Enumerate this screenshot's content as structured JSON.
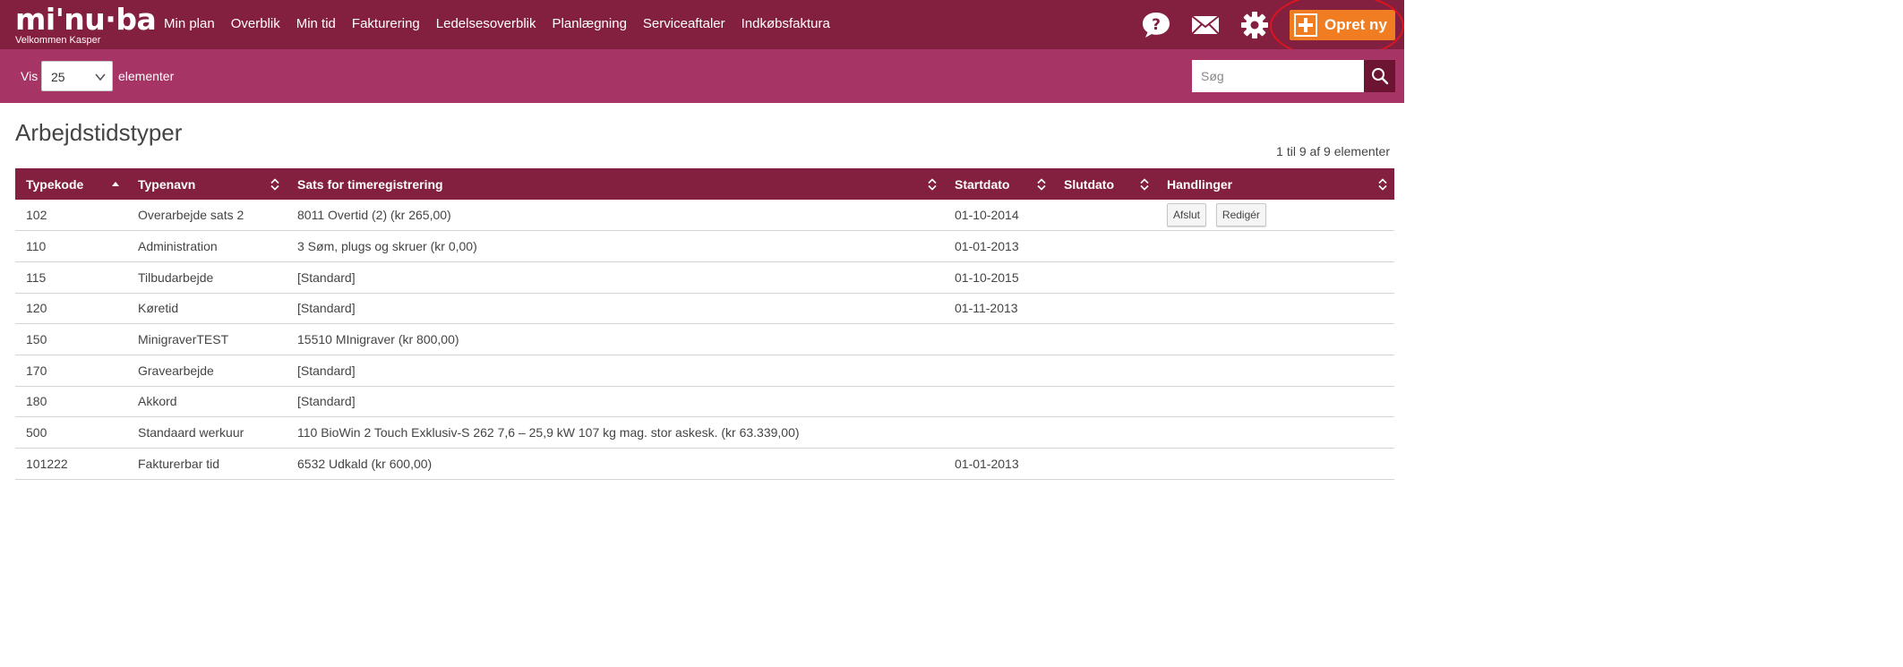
{
  "app": {
    "logo_text": "mi'nu·ba",
    "welcome": "Velkommen  Kasper"
  },
  "nav": {
    "items": [
      {
        "label": "Min plan"
      },
      {
        "label": "Overblik"
      },
      {
        "label": "Min tid"
      },
      {
        "label": "Fakturering"
      },
      {
        "label": "Ledelsesoverblik"
      },
      {
        "label": "Planlægning"
      },
      {
        "label": "Serviceaftaler"
      },
      {
        "label": "Indkøbsfaktura"
      }
    ],
    "icons": [
      "help-icon",
      "mail-icon",
      "gear-icon"
    ],
    "create_label": "Opret ny"
  },
  "toolbar": {
    "vis_label": "Vis",
    "page_size": "25",
    "elements_label": "elementer",
    "search_placeholder": "Søg"
  },
  "page": {
    "title": "Arbejdstidstyper",
    "count_info": "1 til 9 af 9 elementer"
  },
  "table": {
    "columns": [
      {
        "label": "Typekode",
        "sort": "asc"
      },
      {
        "label": "Typenavn",
        "sort": "both"
      },
      {
        "label": "Sats for timeregistrering",
        "sort": "both"
      },
      {
        "label": "Startdato",
        "sort": "both"
      },
      {
        "label": "Slutdato",
        "sort": "both"
      },
      {
        "label": "Handlinger",
        "sort": "both"
      }
    ],
    "rows": [
      {
        "code": "102",
        "name": "Overarbejde sats 2",
        "rate": "8011 Overtid (2) (kr 265,00)",
        "start": "01-10-2014",
        "end": "",
        "actions": [
          "Afslut",
          "Redigér"
        ]
      },
      {
        "code": "110",
        "name": "Administration",
        "rate": "3 Søm, plugs og skruer (kr 0,00)",
        "start": "01-01-2013",
        "end": "",
        "actions": []
      },
      {
        "code": "115",
        "name": "Tilbudarbejde",
        "rate": "[Standard]",
        "start": "01-10-2015",
        "end": "",
        "actions": []
      },
      {
        "code": "120",
        "name": "Køretid",
        "rate": "[Standard]",
        "start": "01-11-2013",
        "end": "",
        "actions": []
      },
      {
        "code": "150",
        "name": "MinigraverTEST",
        "rate": "15510 MInigraver (kr 800,00)",
        "start": "",
        "end": "",
        "actions": []
      },
      {
        "code": "170",
        "name": "Gravearbejde",
        "rate": "[Standard]",
        "start": "",
        "end": "",
        "actions": []
      },
      {
        "code": "180",
        "name": "Akkord",
        "rate": "[Standard]",
        "start": "",
        "end": "",
        "actions": []
      },
      {
        "code": "500",
        "name": "Standaard werkuur",
        "rate": "110 BioWin 2 Touch Exklusiv-S 262 7,6 – 25,9 kW 107 kg mag. stor askesk. (kr 63.339,00)",
        "start": "",
        "end": "",
        "actions": []
      },
      {
        "code": "101222",
        "name": "Fakturerbar tid",
        "rate": "6532 Udkald (kr 600,00)",
        "start": "01-01-2013",
        "end": "",
        "actions": []
      }
    ]
  },
  "colors": {
    "nav_bg": "#84203f",
    "subbar_bg": "#a63565",
    "accent": "#f07d21",
    "annotation": "#e0141e"
  }
}
